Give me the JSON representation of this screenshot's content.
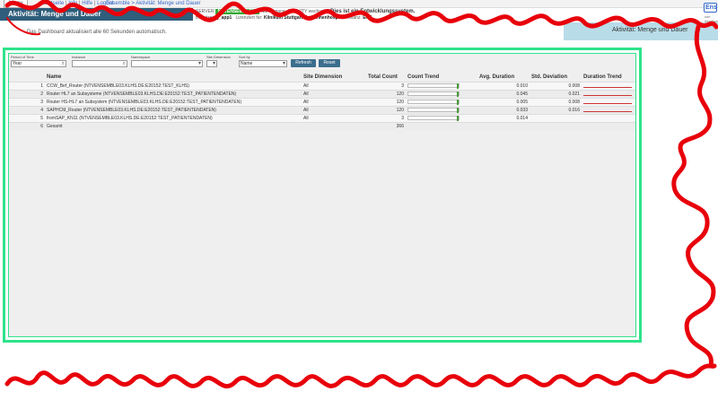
{
  "topbar": {
    "menu_label": "Menu",
    "links": [
      "Startseite",
      "Info",
      "Hilfe",
      "Logout"
    ],
    "breadcrumb": "Ensemble > Aktivität: Menge und Dauer"
  },
  "header": {
    "title": "Aktivität: Menge und Dauer",
    "server_label": "SERVER",
    "server_value": "NTVENSEMBLE03",
    "namespace_text": "Namespace: ACTIVITY wechseln",
    "user_label": "Benutzer:",
    "user_value": "g_app1",
    "licensed_to_label": "Lizenziert für:",
    "licensed_to_value": "Klinikum Stuttgart Katharinenhospital",
    "instance_label": "Instanz:",
    "instance_value": "ENS",
    "dev_note": "Dies ist ein Entwicklungssystem.",
    "logo_text": "Ens",
    "logo_sub": "von InterSystems"
  },
  "refresh_note": "Das Dashboard aktualisiert alle 60 Sekunden automatisch.",
  "active_tab": "Aktivität: Menge und Dauer",
  "filters": {
    "period_label": "Period of Time",
    "period_value": "Year",
    "instance_label": "Instance",
    "instance_value": "",
    "namespace_label": "Namespace",
    "namespace_value": "",
    "site_dimension_label": "Site Dimension",
    "site_dimension_value": "",
    "sort_by_label": "Sort by",
    "sort_by_value": "Name",
    "refresh_label": "Refresh",
    "reset_label": "Reset"
  },
  "table": {
    "headers": [
      "",
      "Name",
      "Site Dimension",
      "Total Count",
      "Count Trend",
      "Avg. Duration",
      "Std. Deviation",
      "Duration Trend"
    ],
    "rows": [
      {
        "n": "1",
        "name": "CCW_Bef_Router (NTVENSEMBLE03.KLHS.DE:E20152:TEST_KLHS)",
        "site": "All",
        "total": "3",
        "avg": "0.010",
        "std": "0.008"
      },
      {
        "n": "2",
        "name": "Router HL7 an Subsysteme (NTVENSEMBLE03.KLHS.DE:E20152:TEST_PATIENTENDATEN)",
        "site": "All",
        "total": "120",
        "avg": "0.045",
        "std": "0.021"
      },
      {
        "n": "3",
        "name": "Router HS-HL7 an Subsystem (NTVENSEMBLE03.KLHS.DE:E20152:TEST_PATIENTENDATEN)",
        "site": "All",
        "total": "120",
        "avg": "0.005",
        "std": "0.008"
      },
      {
        "n": "4",
        "name": "SAPHCM_Router (NTVENSEMBLE03.KLHS.DE:E20152:TEST_PATIENTENDATEN)",
        "site": "All",
        "total": "120",
        "avg": "0.033",
        "std": "0.016"
      },
      {
        "n": "5",
        "name": "fromSAP_KN11 (NTVENSEMBLE03.KLHS.DE:E20152:TEST_PATIENTENDATEN)",
        "site": "All",
        "total": "3",
        "avg": "0.014",
        "std": ""
      },
      {
        "n": "6",
        "name": "Gesamt",
        "site": "",
        "total": "366",
        "avg": "",
        "std": ""
      }
    ]
  },
  "colors": {
    "highlight_frame": "#2ee38a",
    "scribble": "#e8000b",
    "title_band": "#2f5d7b",
    "button": "#3d6e8e"
  }
}
